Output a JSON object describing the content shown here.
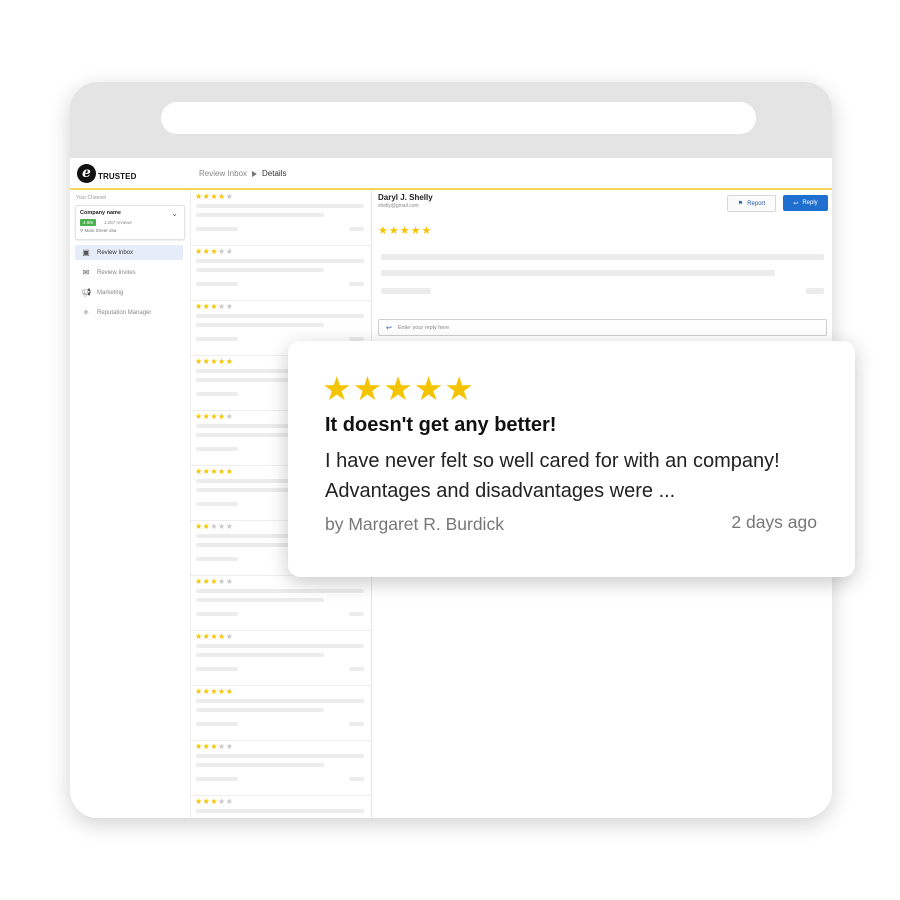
{
  "app": {
    "logo_text": "TRUSTED",
    "breadcrumb": [
      "Review Inbox",
      "Details"
    ]
  },
  "sidebar": {
    "channel_label": "Your Channel",
    "channel": {
      "name": "Company name",
      "score": "4.8/5",
      "reviews": "1.257 reviews",
      "address": "Main Street 15a"
    },
    "items": [
      {
        "label": "Review Inbox",
        "icon": "inbox-icon",
        "active": true
      },
      {
        "label": "Review Invites",
        "icon": "invite-icon",
        "active": false
      },
      {
        "label": "Marketing",
        "icon": "megaphone-icon",
        "active": false
      },
      {
        "label": "Reputation Manager",
        "icon": "sparkle-icon",
        "active": false
      }
    ]
  },
  "review_list": [
    {
      "rating": 4
    },
    {
      "rating": 3
    },
    {
      "rating": 3
    },
    {
      "rating": 5
    },
    {
      "rating": 4
    },
    {
      "rating": 5
    },
    {
      "rating": 2
    },
    {
      "rating": 3
    },
    {
      "rating": 4
    },
    {
      "rating": 5
    },
    {
      "rating": 3
    },
    {
      "rating": 3
    }
  ],
  "detail": {
    "reviewer_name": "Daryl J. Shelly",
    "reviewer_email": "shelly@gmail.com",
    "rating": 5,
    "report_label": "Report",
    "reply_label": "Reply",
    "reply_placeholder": "Enter your reply here"
  },
  "featured_review": {
    "rating": 5,
    "title": "It doesn't get any better!",
    "text": "I have never felt so well cared for with an company! Advantages and disadvantages were ...",
    "author": "by Margaret R. Burdick",
    "time": "2 days ago"
  },
  "colors": {
    "star": "#f5c400",
    "accent_line": "#f3d55c",
    "reply_button": "#1f6fd1",
    "score_badge": "#4caf50"
  }
}
